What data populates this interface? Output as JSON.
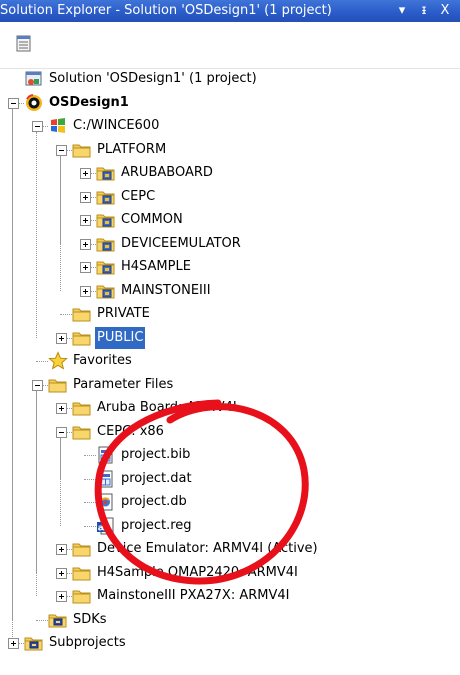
{
  "title": "Solution Explorer - Solution 'OSDesign1' (1 project)",
  "window_buttons": {
    "dropdown": "▾",
    "pin": "ᵻ",
    "close": "X"
  },
  "colors": {
    "titlebar": "#2a5bc8",
    "selection": "#316ac5",
    "annotation": "#e8101a",
    "folder": "#f4cc58"
  },
  "tree": [
    {
      "label": "Solution 'OSDesign1' (1 project)",
      "icon": "solution-icon",
      "level": 0,
      "expander": "none",
      "bold": false,
      "selected": false
    },
    {
      "label": "OSDesign1",
      "icon": "osdesign-icon",
      "level": 0,
      "expander": "minus",
      "bold": true,
      "selected": false
    },
    {
      "label": "C:/WINCE600",
      "icon": "wince-icon",
      "level": 1,
      "expander": "minus",
      "bold": false,
      "selected": false
    },
    {
      "label": "PLATFORM",
      "icon": "folder-icon",
      "level": 2,
      "expander": "minus",
      "bold": false,
      "selected": false
    },
    {
      "label": "ARUBABOARD",
      "icon": "bsp-folder-icon",
      "level": 3,
      "expander": "plus",
      "bold": false,
      "selected": false
    },
    {
      "label": "CEPC",
      "icon": "bsp-folder-icon",
      "level": 3,
      "expander": "plus",
      "bold": false,
      "selected": false
    },
    {
      "label": "COMMON",
      "icon": "bsp-folder-icon",
      "level": 3,
      "expander": "plus",
      "bold": false,
      "selected": false
    },
    {
      "label": "DEVICEEMULATOR",
      "icon": "bsp-folder-icon",
      "level": 3,
      "expander": "plus",
      "bold": false,
      "selected": false
    },
    {
      "label": "H4SAMPLE",
      "icon": "bsp-folder-icon",
      "level": 3,
      "expander": "plus",
      "bold": false,
      "selected": false
    },
    {
      "label": "MAINSTONEIII",
      "icon": "bsp-folder-icon",
      "level": 3,
      "expander": "plus",
      "bold": false,
      "selected": false
    },
    {
      "label": "PRIVATE",
      "icon": "folder-icon",
      "level": 2,
      "expander": "none",
      "bold": false,
      "selected": false
    },
    {
      "label": "PUBLIC",
      "icon": "folder-icon",
      "level": 2,
      "expander": "plus",
      "bold": false,
      "selected": true
    },
    {
      "label": "Favorites",
      "icon": "favorites-star-icon",
      "level": 1,
      "expander": "none",
      "bold": false,
      "selected": false
    },
    {
      "label": "Parameter Files",
      "icon": "folder-icon",
      "level": 1,
      "expander": "minus",
      "bold": false,
      "selected": false
    },
    {
      "label": "Aruba Board: ARMV4I",
      "icon": "folder-icon",
      "level": 2,
      "expander": "plus",
      "bold": false,
      "selected": false
    },
    {
      "label": "CEPC: x86",
      "icon": "folder-icon",
      "level": 2,
      "expander": "minus",
      "bold": false,
      "selected": false
    },
    {
      "label": "project.bib",
      "icon": "bib-file-icon",
      "level": 3,
      "expander": "none",
      "bold": false,
      "selected": false
    },
    {
      "label": "project.dat",
      "icon": "dat-file-icon",
      "level": 3,
      "expander": "none",
      "bold": false,
      "selected": false
    },
    {
      "label": "project.db",
      "icon": "db-file-icon",
      "level": 3,
      "expander": "none",
      "bold": false,
      "selected": false
    },
    {
      "label": "project.reg",
      "icon": "reg-file-icon",
      "level": 3,
      "expander": "none",
      "bold": false,
      "selected": false
    },
    {
      "label": "Device Emulator: ARMV4I (Active)",
      "icon": "folder-icon",
      "level": 2,
      "expander": "plus",
      "bold": false,
      "selected": false
    },
    {
      "label": "H4Sample OMAP2420: ARMV4I",
      "icon": "folder-icon",
      "level": 2,
      "expander": "plus",
      "bold": false,
      "selected": false
    },
    {
      "label": "MainstoneIII PXA27X: ARMV4I",
      "icon": "folder-icon",
      "level": 2,
      "expander": "plus",
      "bold": false,
      "selected": false
    },
    {
      "label": "SDKs",
      "icon": "sdks-folder-icon",
      "level": 1,
      "expander": "none",
      "bold": false,
      "selected": false
    },
    {
      "label": "Subprojects",
      "icon": "subprojects-folder-icon",
      "level": 0,
      "expander": "plus",
      "bold": false,
      "selected": false
    }
  ]
}
